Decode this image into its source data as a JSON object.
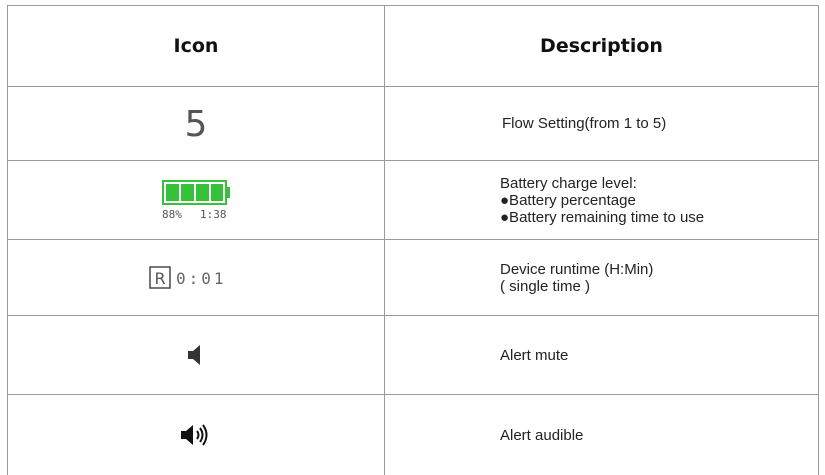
{
  "headers": {
    "icon": "Icon",
    "description": "Description"
  },
  "rows": [
    {
      "icon_name": "flow-setting-icon",
      "icon_text": "5",
      "lines": [
        "Flow Setting(from 1 to 5)"
      ]
    },
    {
      "icon_name": "battery-icon",
      "battery_percent": "88%",
      "battery_time": "1:38",
      "battery_level": 1.0,
      "battery_color": "#35c23a",
      "lines": [
        "Battery charge level:",
        "●Battery percentage",
        "●Battery remaining time to use"
      ]
    },
    {
      "icon_name": "runtime-icon",
      "icon_badge": "R",
      "icon_text": "0:01",
      "lines": [
        "Device runtime (H:Min)",
        "( single time )"
      ]
    },
    {
      "icon_name": "speaker-mute-icon",
      "lines": [
        "Alert mute"
      ]
    },
    {
      "icon_name": "speaker-audible-icon",
      "lines": [
        "Alert audible"
      ]
    }
  ]
}
